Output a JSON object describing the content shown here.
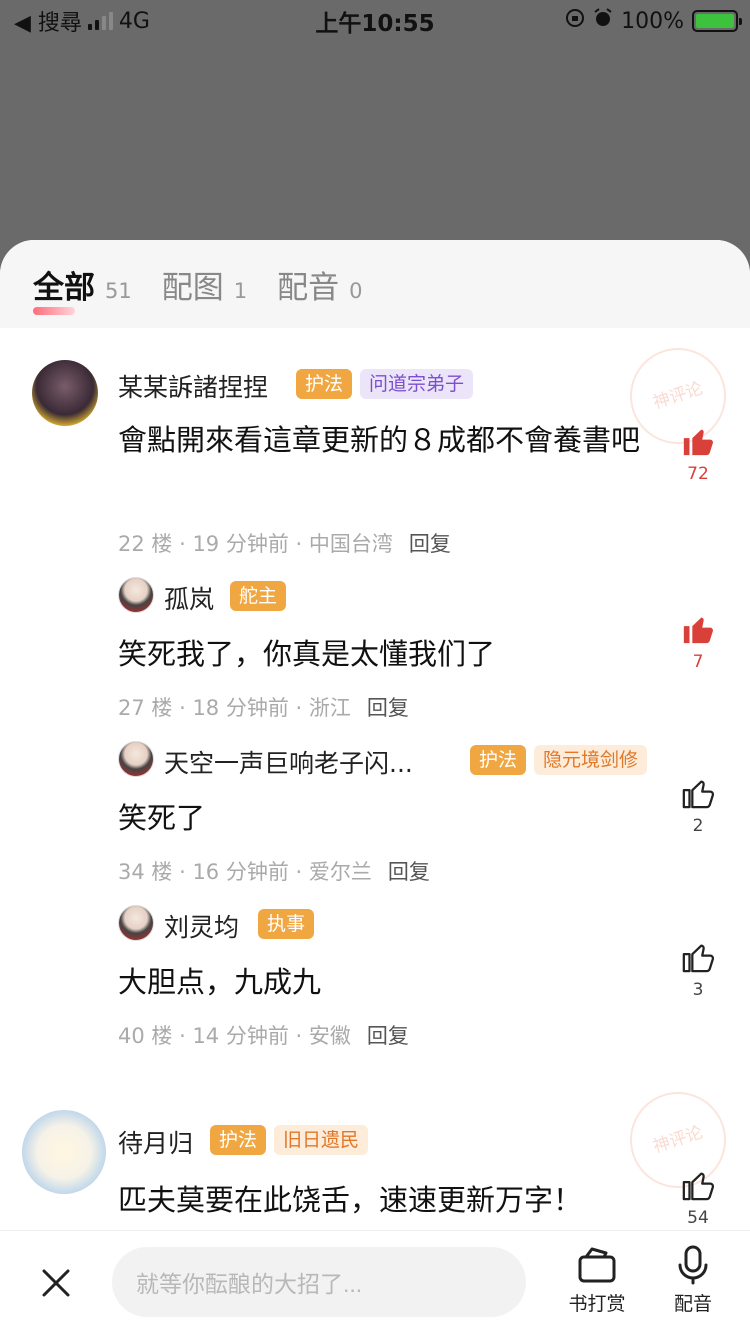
{
  "status_bar": {
    "back_label": "◀ 搜尋",
    "network": "4G",
    "time": "上午10:55",
    "battery": "100%"
  },
  "tabs": [
    {
      "label": "全部",
      "count": "51",
      "active": true
    },
    {
      "label": "配图",
      "count": "1",
      "active": false
    },
    {
      "label": "配音",
      "count": "0",
      "active": false
    }
  ],
  "comments": {
    "c1": {
      "name": "某某訴諸捏捏",
      "badges": [
        "护法",
        "问道宗弟子"
      ],
      "text": "會點開來看這章更新的８成都不會養書吧",
      "floor": "22 楼",
      "time": "19 分钟前",
      "location": "中国台湾",
      "reply": "回复",
      "likes": "72"
    },
    "c2": {
      "name": "孤岚",
      "badges": [
        "舵主"
      ],
      "text": "笑死我了，你真是太懂我们了",
      "floor": "27 楼",
      "time": "18 分钟前",
      "location": "浙江",
      "reply": "回复",
      "likes": "7"
    },
    "c3": {
      "name": "天空一声巨响老子闪...",
      "badges": [
        "护法",
        "隐元境剑修"
      ],
      "text": "笑死了",
      "floor": "34 楼",
      "time": "16 分钟前",
      "location": "爱尔兰",
      "reply": "回复",
      "likes": "2"
    },
    "c4": {
      "name": "刘灵均",
      "badges": [
        "执事"
      ],
      "text": "大胆点，九成九",
      "floor": "40 楼",
      "time": "14 分钟前",
      "location": "安徽",
      "reply": "回复",
      "likes": "3"
    },
    "c5": {
      "name": "待月归",
      "badges": [
        "护法",
        "旧日遗民"
      ],
      "text": "匹夫莫要在此饶舌，速速更新万字！",
      "likes": "54"
    }
  },
  "watermark": "神评论",
  "bottom_bar": {
    "input_placeholder": "就等你酝酿的大招了...",
    "reward_label": "书打赏",
    "voice_label": "配音"
  },
  "colors": {
    "like_active": "#d9403a",
    "badge_orange": "#f0a742",
    "badge_purple_text": "#7a4fd0",
    "badge_peach_text": "#e0782a"
  }
}
